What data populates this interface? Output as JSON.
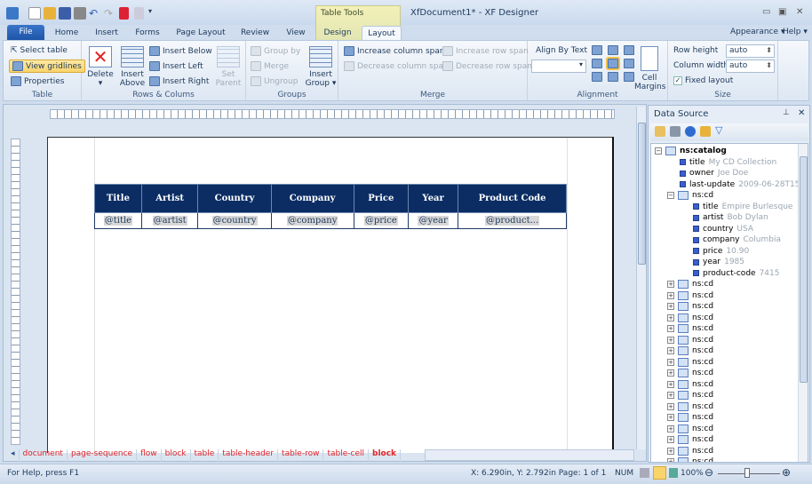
{
  "window": {
    "title": "XfDocument1* - XF Designer",
    "table_tools": "Table Tools",
    "controls": [
      "minimize",
      "maximize",
      "close"
    ]
  },
  "menu_right": {
    "appearance": "Appearance ▾",
    "help": "Help ▾"
  },
  "tabs": {
    "file": "File",
    "items": [
      "Home",
      "Insert",
      "Forms",
      "Page Layout",
      "Review",
      "View",
      "Design",
      "Layout"
    ],
    "active": "Layout"
  },
  "ribbon": {
    "table": {
      "label": "Table",
      "select_table": "Select table",
      "view_gridlines": "View gridlines",
      "properties": "Properties"
    },
    "rows": {
      "label": "Rows & Colums",
      "delete": "Delete",
      "insert_above_1": "Insert",
      "insert_above_2": "Above",
      "insert_below": "Insert Below",
      "insert_left": "Insert Left",
      "insert_right": "Insert Right",
      "set_parent_1": "Set",
      "set_parent_2": "Parent"
    },
    "groups": {
      "label": "Groups",
      "group_by": "Group by",
      "merge": "Merge",
      "ungroup": "Ungroup",
      "insert_group_1": "Insert",
      "insert_group_2": "Group ▾"
    },
    "merge": {
      "label": "Merge",
      "inc_col": "Increase column span",
      "dec_col": "Decrease column span",
      "inc_row": "Increase row span",
      "dec_row": "Decrease row span"
    },
    "alignment": {
      "label": "Alignment",
      "align_by_text": "Align By Text",
      "align_value": "",
      "cell_margins_1": "Cell",
      "cell_margins_2": "Margins"
    },
    "size": {
      "label": "Size",
      "row_height": "Row height",
      "row_height_value": "auto",
      "column_width": "Column width",
      "column_width_value": "auto",
      "fixed_layout": "Fixed layout",
      "fixed_layout_checked": true
    }
  },
  "table": {
    "headers": [
      "Title",
      "Artist",
      "Country",
      "Company",
      "Price",
      "Year",
      "Product Code"
    ],
    "row": [
      "@title",
      "@artist",
      "@country",
      "@company",
      "@price",
      "@year",
      "@product..."
    ],
    "header_color": "#0b2d64"
  },
  "breadcrumb": [
    "document",
    "page-sequence",
    "flow",
    "block",
    "table",
    "table-header",
    "table-row",
    "table-cell",
    "block"
  ],
  "data_source": {
    "title": "Data Source",
    "root": "ns:catalog",
    "root_fields": [
      {
        "name": "title",
        "value": "My CD Collection"
      },
      {
        "name": "owner",
        "value": "Joe Doe"
      },
      {
        "name": "last-update",
        "value": "2009-06-28T15:"
      }
    ],
    "expanded_node": "ns:cd",
    "cd_fields": [
      {
        "name": "title",
        "value": "Empire Burlesque"
      },
      {
        "name": "artist",
        "value": "Bob Dylan"
      },
      {
        "name": "country",
        "value": "USA"
      },
      {
        "name": "company",
        "value": "Columbia"
      },
      {
        "name": "price",
        "value": "10.90"
      },
      {
        "name": "year",
        "value": "1985"
      },
      {
        "name": "product-code",
        "value": "7415"
      }
    ],
    "collapsed_nodes": [
      "ns:cd",
      "ns:cd",
      "ns:cd",
      "ns:cd",
      "ns:cd",
      "ns:cd",
      "ns:cd",
      "ns:cd",
      "ns:cd",
      "ns:cd",
      "ns:cd",
      "ns:cd",
      "ns:cd",
      "ns:cd",
      "ns:cd",
      "ns:cd",
      "ns:cd"
    ]
  },
  "status": {
    "help": "For Help, press F1",
    "position": "X: 6.290in, Y: 2.792in Page: 1 of 1",
    "num": "NUM",
    "zoom": "100%"
  }
}
